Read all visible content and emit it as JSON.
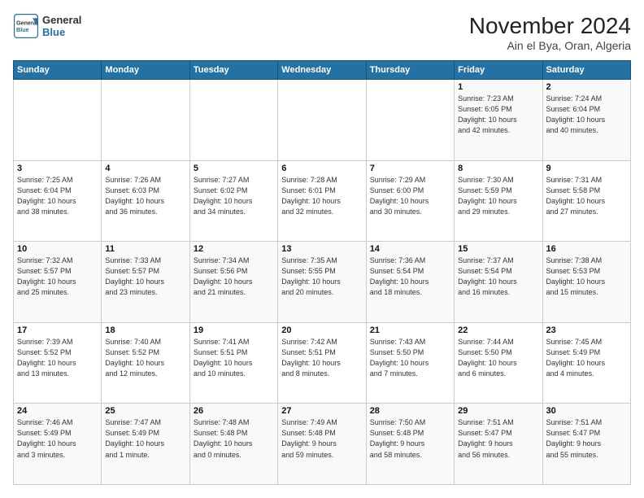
{
  "logo": {
    "line1": "General",
    "line2": "Blue"
  },
  "title": "November 2024",
  "subtitle": "Ain el Bya, Oran, Algeria",
  "header": {
    "days": [
      "Sunday",
      "Monday",
      "Tuesday",
      "Wednesday",
      "Thursday",
      "Friday",
      "Saturday"
    ]
  },
  "weeks": [
    {
      "cells": [
        {
          "day": "",
          "info": ""
        },
        {
          "day": "",
          "info": ""
        },
        {
          "day": "",
          "info": ""
        },
        {
          "day": "",
          "info": ""
        },
        {
          "day": "",
          "info": ""
        },
        {
          "day": "1",
          "info": "Sunrise: 7:23 AM\nSunset: 6:05 PM\nDaylight: 10 hours\nand 42 minutes."
        },
        {
          "day": "2",
          "info": "Sunrise: 7:24 AM\nSunset: 6:04 PM\nDaylight: 10 hours\nand 40 minutes."
        }
      ]
    },
    {
      "cells": [
        {
          "day": "3",
          "info": "Sunrise: 7:25 AM\nSunset: 6:04 PM\nDaylight: 10 hours\nand 38 minutes."
        },
        {
          "day": "4",
          "info": "Sunrise: 7:26 AM\nSunset: 6:03 PM\nDaylight: 10 hours\nand 36 minutes."
        },
        {
          "day": "5",
          "info": "Sunrise: 7:27 AM\nSunset: 6:02 PM\nDaylight: 10 hours\nand 34 minutes."
        },
        {
          "day": "6",
          "info": "Sunrise: 7:28 AM\nSunset: 6:01 PM\nDaylight: 10 hours\nand 32 minutes."
        },
        {
          "day": "7",
          "info": "Sunrise: 7:29 AM\nSunset: 6:00 PM\nDaylight: 10 hours\nand 30 minutes."
        },
        {
          "day": "8",
          "info": "Sunrise: 7:30 AM\nSunset: 5:59 PM\nDaylight: 10 hours\nand 29 minutes."
        },
        {
          "day": "9",
          "info": "Sunrise: 7:31 AM\nSunset: 5:58 PM\nDaylight: 10 hours\nand 27 minutes."
        }
      ]
    },
    {
      "cells": [
        {
          "day": "10",
          "info": "Sunrise: 7:32 AM\nSunset: 5:57 PM\nDaylight: 10 hours\nand 25 minutes."
        },
        {
          "day": "11",
          "info": "Sunrise: 7:33 AM\nSunset: 5:57 PM\nDaylight: 10 hours\nand 23 minutes."
        },
        {
          "day": "12",
          "info": "Sunrise: 7:34 AM\nSunset: 5:56 PM\nDaylight: 10 hours\nand 21 minutes."
        },
        {
          "day": "13",
          "info": "Sunrise: 7:35 AM\nSunset: 5:55 PM\nDaylight: 10 hours\nand 20 minutes."
        },
        {
          "day": "14",
          "info": "Sunrise: 7:36 AM\nSunset: 5:54 PM\nDaylight: 10 hours\nand 18 minutes."
        },
        {
          "day": "15",
          "info": "Sunrise: 7:37 AM\nSunset: 5:54 PM\nDaylight: 10 hours\nand 16 minutes."
        },
        {
          "day": "16",
          "info": "Sunrise: 7:38 AM\nSunset: 5:53 PM\nDaylight: 10 hours\nand 15 minutes."
        }
      ]
    },
    {
      "cells": [
        {
          "day": "17",
          "info": "Sunrise: 7:39 AM\nSunset: 5:52 PM\nDaylight: 10 hours\nand 13 minutes."
        },
        {
          "day": "18",
          "info": "Sunrise: 7:40 AM\nSunset: 5:52 PM\nDaylight: 10 hours\nand 12 minutes."
        },
        {
          "day": "19",
          "info": "Sunrise: 7:41 AM\nSunset: 5:51 PM\nDaylight: 10 hours\nand 10 minutes."
        },
        {
          "day": "20",
          "info": "Sunrise: 7:42 AM\nSunset: 5:51 PM\nDaylight: 10 hours\nand 8 minutes."
        },
        {
          "day": "21",
          "info": "Sunrise: 7:43 AM\nSunset: 5:50 PM\nDaylight: 10 hours\nand 7 minutes."
        },
        {
          "day": "22",
          "info": "Sunrise: 7:44 AM\nSunset: 5:50 PM\nDaylight: 10 hours\nand 6 minutes."
        },
        {
          "day": "23",
          "info": "Sunrise: 7:45 AM\nSunset: 5:49 PM\nDaylight: 10 hours\nand 4 minutes."
        }
      ]
    },
    {
      "cells": [
        {
          "day": "24",
          "info": "Sunrise: 7:46 AM\nSunset: 5:49 PM\nDaylight: 10 hours\nand 3 minutes."
        },
        {
          "day": "25",
          "info": "Sunrise: 7:47 AM\nSunset: 5:49 PM\nDaylight: 10 hours\nand 1 minute."
        },
        {
          "day": "26",
          "info": "Sunrise: 7:48 AM\nSunset: 5:48 PM\nDaylight: 10 hours\nand 0 minutes."
        },
        {
          "day": "27",
          "info": "Sunrise: 7:49 AM\nSunset: 5:48 PM\nDaylight: 9 hours\nand 59 minutes."
        },
        {
          "day": "28",
          "info": "Sunrise: 7:50 AM\nSunset: 5:48 PM\nDaylight: 9 hours\nand 58 minutes."
        },
        {
          "day": "29",
          "info": "Sunrise: 7:51 AM\nSunset: 5:47 PM\nDaylight: 9 hours\nand 56 minutes."
        },
        {
          "day": "30",
          "info": "Sunrise: 7:51 AM\nSunset: 5:47 PM\nDaylight: 9 hours\nand 55 minutes."
        }
      ]
    }
  ]
}
